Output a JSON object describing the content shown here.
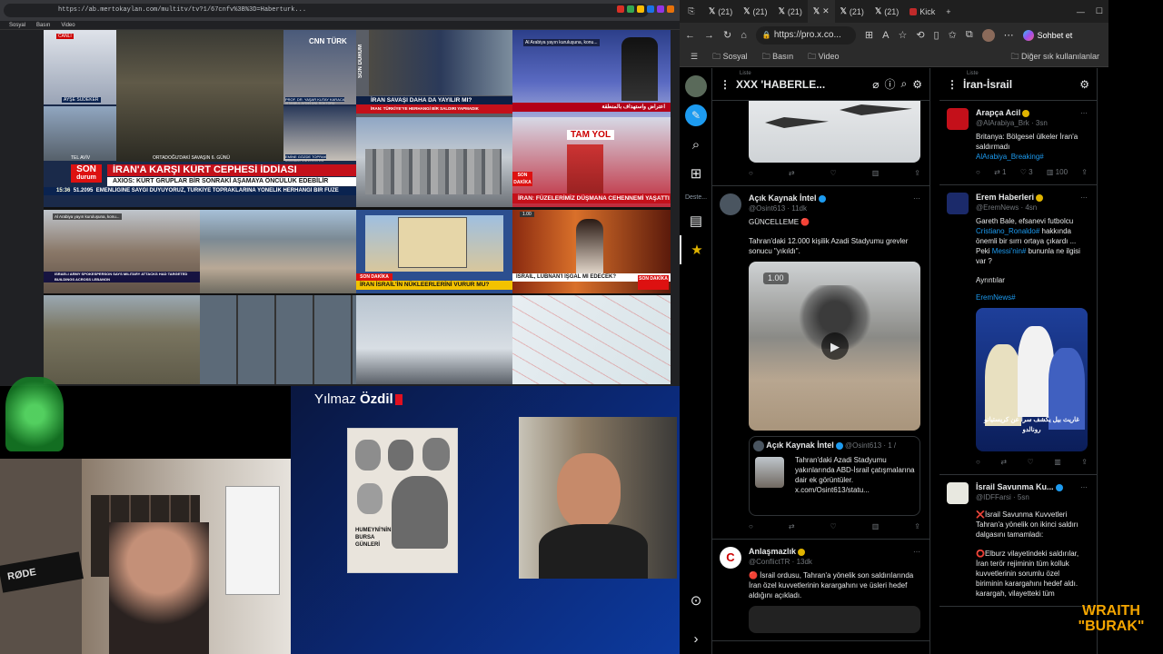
{
  "left_browser": {
    "url": "https://ab.mertokaylan.com/multitv/tv?1/67cnfv%3B%3D=Haberturk...",
    "bookmarks": [
      "Sosyal",
      "Basın",
      "Video"
    ],
    "extension_colors": [
      "#d93025",
      "#34a853",
      "#fbbc04",
      "#1a73e8",
      "#9334e6",
      "#e8710a"
    ]
  },
  "news_wall": {
    "cnn": {
      "live": "CANLI",
      "logo": "CNN TÜRK",
      "person1": "AYŞE SUDEKER",
      "person2": "PROF. DR. YAŞAR KUTAY KARACA",
      "person2_title": "İSTANBUL AYDIN ÜNİ. RÖKTÖRÜ",
      "person3": "EMİNE GÖZDE TOPRAK",
      "person3_title": "ÜSKÜDAR UNİVERSİTESİ",
      "location": "TEL AVİV",
      "day_text": "ORTADOĞU'DAKİ SAVAŞIN 6. GÜNÜ",
      "son": "SON",
      "durum": "durum",
      "headline": "İRAN'A KARŞI KÜRT CEPHESİ İDDİASI",
      "subheadline": "AXIOS: KÜRT GRUPLAR BİR SONRAKİ AŞAMAYA ÖNCÜLÜK EDEBİLİR",
      "ticker": "EMENLİĞİNE SAYGI DUYUYORUZ, TÜRKİYE TOPRAKLARINA YÖNELİK HERHANGİ BİR FÜZE",
      "time": "15:36",
      "bist": "51.2095"
    },
    "ntv": {
      "side": "SON DURUM",
      "headline": "İRAN SAVAŞI DAHA DA YAYILIR MI?",
      "sub": "İRAN: TÜRKİYE'YE HERHANGİ BİR SALDIRI YAPMADIK"
    },
    "alarabiya": {
      "tag": "Al Arabiya yayın kuruluşuna, konu...",
      "ticker": "اعتراض واستهداف بالمنطقة"
    },
    "tv_top": {
      "logo": "TAM YOL",
      "son": "SON DAKİKA",
      "headline": "İRAN: FÜZELERİMİZ DÜŞMANA CEHENNEMİ YAŞATTI"
    },
    "mid_left": {
      "tag": "Al Arabiya yayın kuruluşuna, konu...",
      "caption": "ISRAELI ARMY SPOKESPERSON SAYS MILITARY ATTACKS HAD TARGETED BUILDINGS ACROSS LEBANON"
    },
    "mid_map": {
      "son": "SON DAKİKA",
      "headline": "İRAN İSRAİL'İN NÜKLEERLERİNİ VURUR MU?"
    },
    "mid_right": {
      "badge": "1.00",
      "headline": "İSRAİL, LÜBNAN'I İŞGAL Mİ EDECEK?",
      "son": "SON DAKİKA"
    }
  },
  "right_browser": {
    "tabs": [
      {
        "label": "(21)",
        "icon": "x-logo"
      },
      {
        "label": "(21)",
        "icon": "x-logo"
      },
      {
        "label": "(21)",
        "icon": "x-logo"
      },
      {
        "label": "",
        "icon": "x-logo"
      },
      {
        "label": "(21)",
        "icon": "x-logo"
      },
      {
        "label": "(21)",
        "icon": "x-logo"
      },
      {
        "label": "Kick",
        "icon": "kick-logo"
      }
    ],
    "url": "https://pro.x.co...",
    "profile_button": "Sohbet et",
    "bookmarks": [
      "Sosyal",
      "Basın",
      "Video"
    ],
    "other_bookmarks": "Diğer sık kullanılanlar"
  },
  "sidebar": {
    "labels": [
      "Deste...",
      ""
    ]
  },
  "column1": {
    "list_label": "Liste",
    "title": "XXX 'HABERLE...",
    "tweet1": {
      "name": "Açık Kaynak İntel",
      "handle": "@Osint613 · 11dk",
      "text1": "GÜNCELLEME 🔴",
      "text2": "Tahran'daki 12.000 kişilik Azadi Stadyumu grevler sonucu \"yıkıldı\".",
      "video_time": "1.00",
      "quote_name": "Açık Kaynak İntel",
      "quote_handle": "@Osint613 · 1 /",
      "quote_text": "Tahran'daki Azadi Stadyumu yakınlarında ABD-İsrail çatışmalarına dair ek görüntüler.",
      "quote_link": "x.com/Osint613/statu..."
    },
    "tweet2": {
      "name": "Anlaşmazlık",
      "handle": "@ConflictTR · 13dk",
      "text": "🔴 İsrail ordusu, Tahran'a yönelik son saldırılarında İran özel kuvvetlerinin karargahını ve üsleri hedef aldığını açıkladı."
    }
  },
  "column2": {
    "list_label": "Liste",
    "title": "İran-İsrail",
    "tweet1": {
      "name": "Arapça Acil",
      "handle": "@AlArabiya_Brk · 3sn",
      "text": "Britanya: Bölgesel ülkeler İran'a saldırmadı",
      "hashtag": "AlArabiya_Breaking#",
      "stats": [
        "1",
        "3",
        "100"
      ]
    },
    "tweet2": {
      "name": "Erem Haberleri",
      "handle": "@EremNews · 4sn",
      "text_a": "Gareth Bale, efsanevi futbolcu",
      "link_a": "Cristiano_Ronaldo#",
      "text_b": "hakkında önemli bir sırrı ortaya çıkardı ... Peki",
      "link_b": "Messi'nin#",
      "text_c": "bununla ne ilgisi var ?",
      "details": "Ayrıntılar",
      "hashtag": "EremNews#",
      "img_caption": "غاريث بيل يكشف سرا عن كريستيانو رونالدو"
    },
    "tweet3": {
      "name": "İsrail Savunma Ku...",
      "handle": "@IDFFarsi · 5sn",
      "text1": "❌İsrail Savunma Kuvvetleri Tahran'a yönelik on ikinci saldırı dalgasını tamamladı:",
      "text2": "⭕Elburz vilayetindeki saldırılar, İran terör rejiminin tüm kolluk kuvvetlerinin sorumlu özel biriminin karargahını hedef aldı. karargah, vilayetteki tüm"
    }
  },
  "tv_show": {
    "host_first": "Yılmaz",
    "host_last": "Özdil",
    "poster": "HUMEYNİ'NİN BURSA GÜNLERİ"
  },
  "webcam": {
    "mic_brand": "RØDE"
  },
  "overlay": {
    "line1": "WRAITH",
    "line2": "\"BURAK\""
  }
}
